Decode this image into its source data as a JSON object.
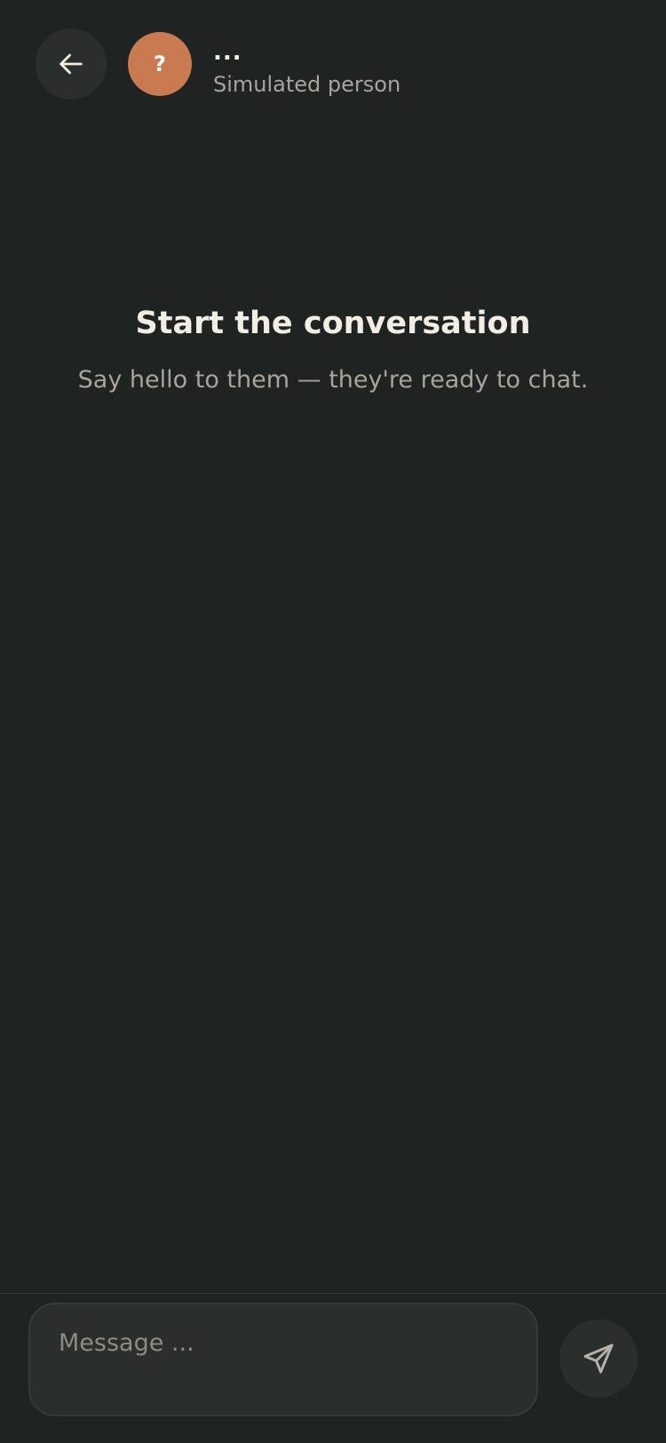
{
  "header": {
    "back_icon": "arrow-left-icon",
    "avatar_text": "?",
    "avatar_color": "#c97a50",
    "contact_name": "...",
    "contact_subtitle": "Simulated person"
  },
  "empty_state": {
    "title": "Start the conversation",
    "subtitle": "Say hello to them — they're ready to chat."
  },
  "composer": {
    "placeholder": "Message ...",
    "value": "",
    "send_icon": "send-icon"
  },
  "colors": {
    "background": "#1f2321",
    "surface": "#2a2e2c",
    "text_primary": "#f2eee6",
    "text_secondary": "#a8a49b",
    "accent": "#c97a50"
  }
}
